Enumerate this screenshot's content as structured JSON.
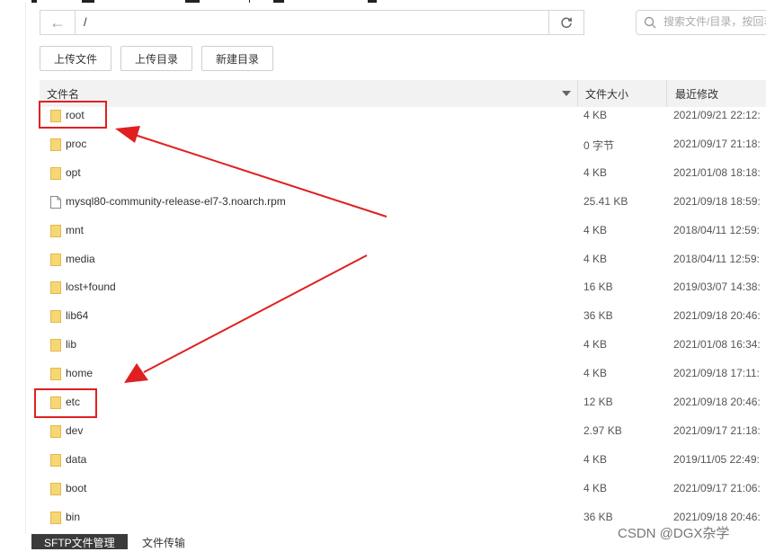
{
  "toolbar": {
    "path": "/",
    "search_placeholder": "搜索文件/目录，按回车",
    "buttons": [
      "上传文件",
      "上传目录",
      "新建目录"
    ]
  },
  "table": {
    "headers": {
      "name": "文件名",
      "size": "文件大小",
      "modified": "最近修改"
    },
    "rows": [
      {
        "type": "folder",
        "name": "root",
        "size": "4 KB",
        "modified": "2021/09/21 22:12:",
        "highlight": true
      },
      {
        "type": "folder",
        "name": "proc",
        "size": "0 字节",
        "modified": "2021/09/17 21:18:"
      },
      {
        "type": "folder",
        "name": "opt",
        "size": "4 KB",
        "modified": "2021/01/08 18:18:"
      },
      {
        "type": "file",
        "name": "mysql80-community-release-el7-3.noarch.rpm",
        "size": "25.41 KB",
        "modified": "2021/09/18 18:59:"
      },
      {
        "type": "folder",
        "name": "mnt",
        "size": "4 KB",
        "modified": "2018/04/11 12:59:"
      },
      {
        "type": "folder",
        "name": "media",
        "size": "4 KB",
        "modified": "2018/04/11 12:59:"
      },
      {
        "type": "folder",
        "name": "lost+found",
        "size": "16 KB",
        "modified": "2019/03/07 14:38:"
      },
      {
        "type": "folder",
        "name": "lib64",
        "size": "36 KB",
        "modified": "2021/09/18 20:46:"
      },
      {
        "type": "folder",
        "name": "lib",
        "size": "4 KB",
        "modified": "2021/01/08 16:34:"
      },
      {
        "type": "folder",
        "name": "home",
        "size": "4 KB",
        "modified": "2021/09/18 17:11:"
      },
      {
        "type": "folder",
        "name": "etc",
        "size": "12 KB",
        "modified": "2021/09/18 20:46:",
        "highlight": true
      },
      {
        "type": "folder",
        "name": "dev",
        "size": "2.97 KB",
        "modified": "2021/09/17 21:18:"
      },
      {
        "type": "folder",
        "name": "data",
        "size": "4 KB",
        "modified": "2019/11/05 22:49:"
      },
      {
        "type": "folder",
        "name": "boot",
        "size": "4 KB",
        "modified": "2021/09/17 21:06:"
      },
      {
        "type": "folder",
        "name": "bin",
        "size": "36 KB",
        "modified": "2021/09/18 20:46:"
      }
    ]
  },
  "bottom_tabs": [
    "SFTP文件管理",
    "文件传输"
  ],
  "watermark": "CSDN @DGX杂学",
  "colors": {
    "annotation": "#e02020",
    "folder": "#f7d774",
    "folder_stroke": "#e3b84a",
    "active_tab": "#3b3b3b"
  }
}
